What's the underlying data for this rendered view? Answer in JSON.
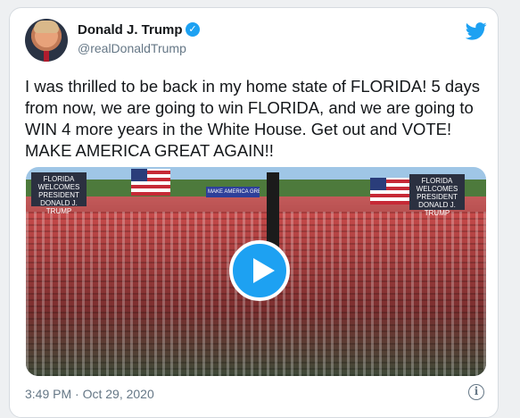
{
  "author": {
    "name": "Donald J. Trump",
    "handle": "@realDonaldTrump",
    "verified_glyph": "✓"
  },
  "tweet": {
    "text": "I was thrilled to be back in my home state of FLORIDA! 5 days\nfrom now, we are going to win FLORIDA, and we are going to\nWIN 4 more years in the White House. Get out and VOTE!\nMAKE AMERICA GREAT AGAIN!!",
    "timestamp": "3:49 PM · Oct 29, 2020"
  },
  "media": {
    "sign_left": "FLORIDA\nWELCOMES\nPRESIDENT\nDONALD J. TRUMP",
    "sign_center": "MAKE AMERICA GREAT AGAIN",
    "sign_right": "FLORIDA\nWELCOMES\nPRESIDENT\nDONALD J. TRUMP"
  },
  "icons": {
    "brand": "twitter-bird-icon",
    "verified": "verified-badge-icon",
    "play": "play-icon",
    "info": "info-icon",
    "info_glyph": "i"
  },
  "colors": {
    "accent": "#1da1f2",
    "text": "#14171a",
    "muted": "#657786"
  }
}
